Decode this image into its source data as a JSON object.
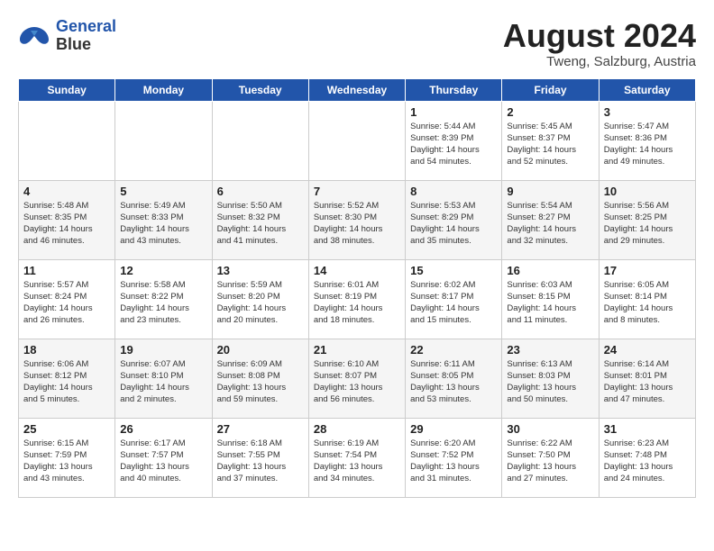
{
  "header": {
    "logo_line1": "General",
    "logo_line2": "Blue",
    "month_year": "August 2024",
    "location": "Tweng, Salzburg, Austria"
  },
  "days_of_week": [
    "Sunday",
    "Monday",
    "Tuesday",
    "Wednesday",
    "Thursday",
    "Friday",
    "Saturday"
  ],
  "weeks": [
    [
      {
        "day": "",
        "info": ""
      },
      {
        "day": "",
        "info": ""
      },
      {
        "day": "",
        "info": ""
      },
      {
        "day": "",
        "info": ""
      },
      {
        "day": "1",
        "info": "Sunrise: 5:44 AM\nSunset: 8:39 PM\nDaylight: 14 hours\nand 54 minutes."
      },
      {
        "day": "2",
        "info": "Sunrise: 5:45 AM\nSunset: 8:37 PM\nDaylight: 14 hours\nand 52 minutes."
      },
      {
        "day": "3",
        "info": "Sunrise: 5:47 AM\nSunset: 8:36 PM\nDaylight: 14 hours\nand 49 minutes."
      }
    ],
    [
      {
        "day": "4",
        "info": "Sunrise: 5:48 AM\nSunset: 8:35 PM\nDaylight: 14 hours\nand 46 minutes."
      },
      {
        "day": "5",
        "info": "Sunrise: 5:49 AM\nSunset: 8:33 PM\nDaylight: 14 hours\nand 43 minutes."
      },
      {
        "day": "6",
        "info": "Sunrise: 5:50 AM\nSunset: 8:32 PM\nDaylight: 14 hours\nand 41 minutes."
      },
      {
        "day": "7",
        "info": "Sunrise: 5:52 AM\nSunset: 8:30 PM\nDaylight: 14 hours\nand 38 minutes."
      },
      {
        "day": "8",
        "info": "Sunrise: 5:53 AM\nSunset: 8:29 PM\nDaylight: 14 hours\nand 35 minutes."
      },
      {
        "day": "9",
        "info": "Sunrise: 5:54 AM\nSunset: 8:27 PM\nDaylight: 14 hours\nand 32 minutes."
      },
      {
        "day": "10",
        "info": "Sunrise: 5:56 AM\nSunset: 8:25 PM\nDaylight: 14 hours\nand 29 minutes."
      }
    ],
    [
      {
        "day": "11",
        "info": "Sunrise: 5:57 AM\nSunset: 8:24 PM\nDaylight: 14 hours\nand 26 minutes."
      },
      {
        "day": "12",
        "info": "Sunrise: 5:58 AM\nSunset: 8:22 PM\nDaylight: 14 hours\nand 23 minutes."
      },
      {
        "day": "13",
        "info": "Sunrise: 5:59 AM\nSunset: 8:20 PM\nDaylight: 14 hours\nand 20 minutes."
      },
      {
        "day": "14",
        "info": "Sunrise: 6:01 AM\nSunset: 8:19 PM\nDaylight: 14 hours\nand 18 minutes."
      },
      {
        "day": "15",
        "info": "Sunrise: 6:02 AM\nSunset: 8:17 PM\nDaylight: 14 hours\nand 15 minutes."
      },
      {
        "day": "16",
        "info": "Sunrise: 6:03 AM\nSunset: 8:15 PM\nDaylight: 14 hours\nand 11 minutes."
      },
      {
        "day": "17",
        "info": "Sunrise: 6:05 AM\nSunset: 8:14 PM\nDaylight: 14 hours\nand 8 minutes."
      }
    ],
    [
      {
        "day": "18",
        "info": "Sunrise: 6:06 AM\nSunset: 8:12 PM\nDaylight: 14 hours\nand 5 minutes."
      },
      {
        "day": "19",
        "info": "Sunrise: 6:07 AM\nSunset: 8:10 PM\nDaylight: 14 hours\nand 2 minutes."
      },
      {
        "day": "20",
        "info": "Sunrise: 6:09 AM\nSunset: 8:08 PM\nDaylight: 13 hours\nand 59 minutes."
      },
      {
        "day": "21",
        "info": "Sunrise: 6:10 AM\nSunset: 8:07 PM\nDaylight: 13 hours\nand 56 minutes."
      },
      {
        "day": "22",
        "info": "Sunrise: 6:11 AM\nSunset: 8:05 PM\nDaylight: 13 hours\nand 53 minutes."
      },
      {
        "day": "23",
        "info": "Sunrise: 6:13 AM\nSunset: 8:03 PM\nDaylight: 13 hours\nand 50 minutes."
      },
      {
        "day": "24",
        "info": "Sunrise: 6:14 AM\nSunset: 8:01 PM\nDaylight: 13 hours\nand 47 minutes."
      }
    ],
    [
      {
        "day": "25",
        "info": "Sunrise: 6:15 AM\nSunset: 7:59 PM\nDaylight: 13 hours\nand 43 minutes."
      },
      {
        "day": "26",
        "info": "Sunrise: 6:17 AM\nSunset: 7:57 PM\nDaylight: 13 hours\nand 40 minutes."
      },
      {
        "day": "27",
        "info": "Sunrise: 6:18 AM\nSunset: 7:55 PM\nDaylight: 13 hours\nand 37 minutes."
      },
      {
        "day": "28",
        "info": "Sunrise: 6:19 AM\nSunset: 7:54 PM\nDaylight: 13 hours\nand 34 minutes."
      },
      {
        "day": "29",
        "info": "Sunrise: 6:20 AM\nSunset: 7:52 PM\nDaylight: 13 hours\nand 31 minutes."
      },
      {
        "day": "30",
        "info": "Sunrise: 6:22 AM\nSunset: 7:50 PM\nDaylight: 13 hours\nand 27 minutes."
      },
      {
        "day": "31",
        "info": "Sunrise: 6:23 AM\nSunset: 7:48 PM\nDaylight: 13 hours\nand 24 minutes."
      }
    ]
  ]
}
